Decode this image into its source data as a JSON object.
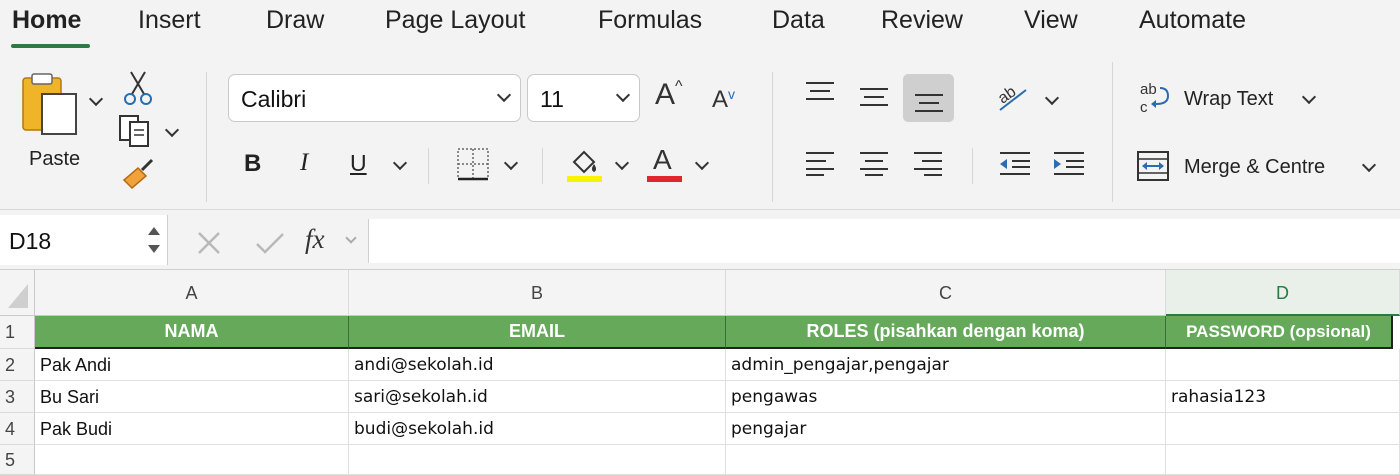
{
  "tabs": [
    {
      "label": "Home",
      "active": true
    },
    {
      "label": "Insert"
    },
    {
      "label": "Draw"
    },
    {
      "label": "Page Layout"
    },
    {
      "label": "Formulas"
    },
    {
      "label": "Data"
    },
    {
      "label": "Review"
    },
    {
      "label": "View"
    },
    {
      "label": "Automate"
    }
  ],
  "ribbon": {
    "paste_label": "Paste",
    "font_name": "Calibri",
    "font_size": "11",
    "bold": "B",
    "italic": "I",
    "underline": "U",
    "wrap_text": "Wrap Text",
    "merge_centre": "Merge & Centre",
    "highlight_color": "#f5f500",
    "font_color": "#e0262b",
    "selected_alignment": "align-bottom"
  },
  "formula_bar": {
    "name_box": "D18",
    "fx": "fx",
    "formula": ""
  },
  "grid": {
    "columns": [
      "A",
      "B",
      "C",
      "D"
    ],
    "selected_column": "D",
    "row_numbers": [
      "1",
      "2",
      "3",
      "4",
      "5"
    ],
    "header_fill": "#66a95b",
    "headers": [
      "NAMA",
      "EMAIL",
      "ROLES (pisahkan dengan koma)",
      "PASSWORD (opsional)"
    ],
    "rows": [
      [
        "Pak Andi",
        "andi@sekolah.id",
        "admin_pengajar,pengajar",
        ""
      ],
      [
        "Bu Sari",
        "sari@sekolah.id",
        "pengawas",
        "rahasia123"
      ],
      [
        "Pak Budi",
        "budi@sekolah.id",
        "pengajar",
        ""
      ]
    ]
  }
}
